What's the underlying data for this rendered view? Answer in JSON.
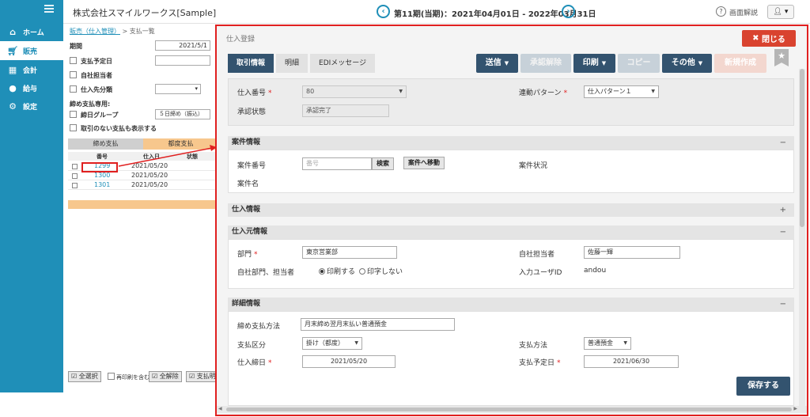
{
  "sidebar": {
    "items": [
      {
        "label": "ホーム",
        "icon": "home-icon"
      },
      {
        "label": "販売",
        "icon": "cart-icon"
      },
      {
        "label": "会計",
        "icon": "calculator-icon"
      },
      {
        "label": "給与",
        "icon": "money-bag-icon"
      },
      {
        "label": "設定",
        "icon": "gear-icon"
      }
    ]
  },
  "header": {
    "company": "株式会社スマイルワークス[Sample]",
    "period": "第11期(当期)：2021年04月01日 - 2022年03月31日",
    "help": "画面解説"
  },
  "list": {
    "breadcrumb_link": "販売（仕入管理）",
    "breadcrumb_rest": " > 支払一覧",
    "period_label": "期間",
    "period_value": "2021/5/1",
    "due_label": "支払予定日",
    "staff_label": "自社担当者",
    "supplier_label": "仕入先分類",
    "closing_label": "締め支払専用:",
    "closing_group_label": "締日グループ",
    "closing_group_value": "５日締め（振込）",
    "show_no_txn_label": "取引のない支払も表示する",
    "tab1": "締め支払",
    "tab2": "都度支払",
    "col_no": "番号",
    "col_date": "仕入日",
    "col_status": "状態",
    "rows": [
      {
        "no": "1299",
        "date": "2021/05/20"
      },
      {
        "no": "1300",
        "date": "2021/05/20"
      },
      {
        "no": "1301",
        "date": "2021/05/20"
      }
    ],
    "btn_select_all": "全選択",
    "cb_reprint": "再印刷を含む",
    "btn_clear_all": "全解除",
    "btn_pay": "支払明"
  },
  "modal": {
    "title": "仕入登録",
    "close": "閉じる",
    "tabs": [
      "取引情報",
      "明細",
      "EDIメッセージ"
    ],
    "actions": {
      "send": "送信",
      "unapprove": "承認解除",
      "print": "印刷",
      "copy": "コピー",
      "other": "その他",
      "new": "新規作成"
    },
    "top": {
      "purchase_no_label": "仕入番号",
      "purchase_no_value": "80",
      "pattern_label": "連動パターン",
      "pattern_value": "仕入パターン１",
      "approval_label": "承認状態",
      "approval_value": "承認完了"
    },
    "project": {
      "title": "案件情報",
      "toggle": "−",
      "no_label": "案件番号",
      "no_placeholder": "番号",
      "search_btn": "検索",
      "move_btn": "案件へ移動",
      "status_label": "案件状況",
      "name_label": "案件名"
    },
    "purchase": {
      "title": "仕入情報",
      "toggle": "+"
    },
    "supplier": {
      "title": "仕入元情報",
      "toggle": "−",
      "dept_label": "部門",
      "dept_value": "東京営業部",
      "staff_label": "自社担当者",
      "staff_value": "佐藤一輝",
      "print_label": "自社部門、担当者",
      "print_on": "印刷する",
      "print_off": "印字しない",
      "input_user_label": "入力ユーザID",
      "input_user_value": "andou"
    },
    "detail": {
      "title": "詳細情報",
      "toggle": "−",
      "closing_method_label": "締め支払方法",
      "closing_method_value": "月末締め翌月末払い普通預金",
      "pay_class_label": "支払区分",
      "pay_class_value": "掛け（都度）",
      "pay_method_label": "支払方法",
      "pay_method_value": "普通預金",
      "closing_date_label": "仕入締日",
      "closing_date_value": "2021/05/20",
      "due_date_label": "支払予定日",
      "due_date_value": "2021/06/30"
    },
    "save": "保存する"
  },
  "colors": {
    "brand": "#1f8fb8",
    "dark_button": "#33536f",
    "close_button": "#d9432f",
    "highlight": "#e02020",
    "tab_orange": "#f7c78d"
  }
}
